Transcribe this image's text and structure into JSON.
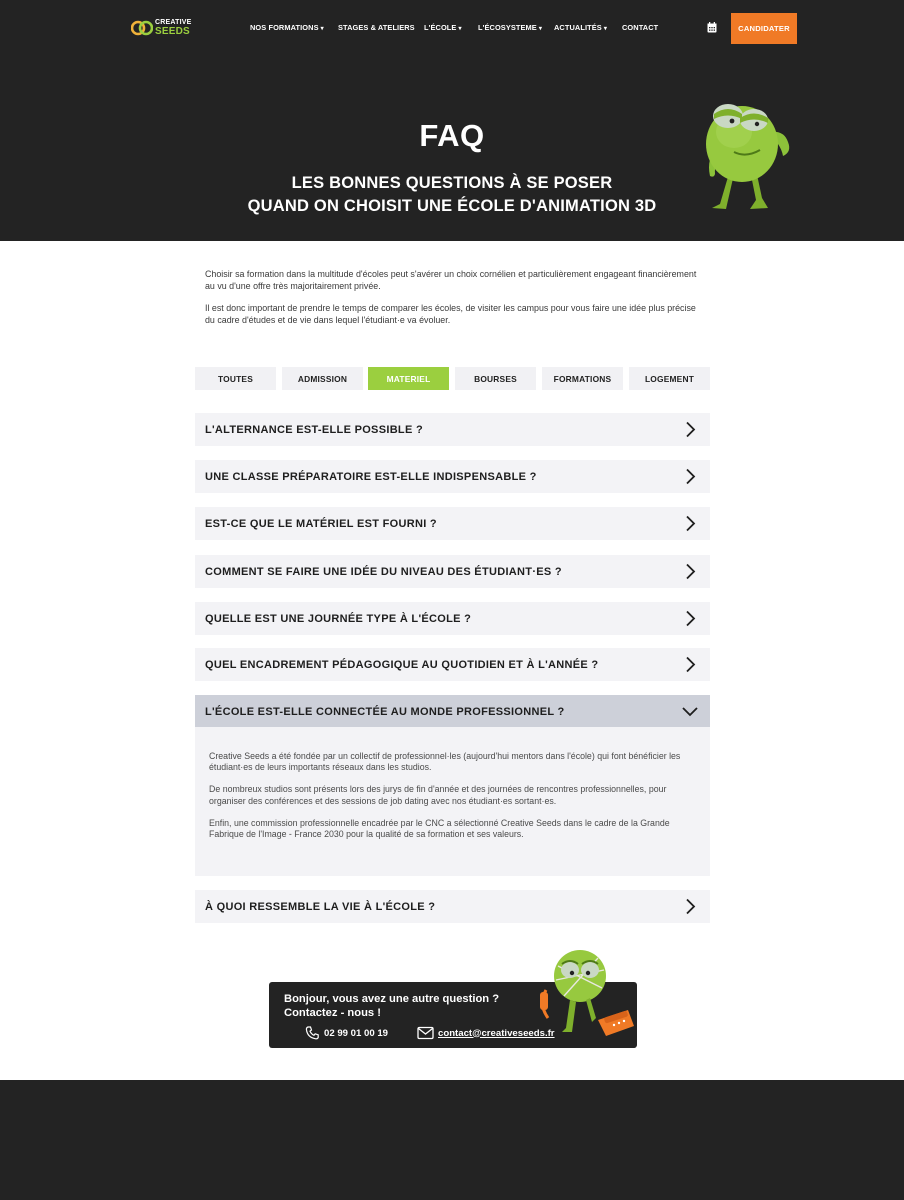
{
  "brand": {
    "name_top": "CREATIVE",
    "name_bottom": "SEEDS",
    "colors": {
      "dark": "#232323",
      "accent_green": "#9bcf3f",
      "accent_orange": "#f07a26"
    }
  },
  "nav": {
    "items": [
      {
        "label": "NOS FORMATIONS",
        "has_dropdown": true
      },
      {
        "label": "STAGES & ATELIERS",
        "has_dropdown": false
      },
      {
        "label": "L'ÉCOLE",
        "has_dropdown": true
      },
      {
        "label": "L'ÉCOSYSTEME",
        "has_dropdown": true
      },
      {
        "label": "ACTUALITÉS",
        "has_dropdown": true
      },
      {
        "label": "CONTACT",
        "has_dropdown": false
      }
    ],
    "caret": "▾",
    "calendar_icon": "calendar-icon",
    "cta_label": "CANDIDATER"
  },
  "hero": {
    "title": "FAQ",
    "subtitle_line1": "LES BONNES QUESTIONS À SE POSER",
    "subtitle_line2": "QUAND ON CHOISIT UNE ÉCOLE D'ANIMATION 3D"
  },
  "intro": {
    "p1": "Choisir sa formation dans la multitude d'écoles peut s'avérer un choix cornélien et particulièrement engageant financièrement au vu d'une offre très majoritairement privée.",
    "p2": "Il est donc important de prendre le temps de comparer les écoles, de visiter les campus pour vous faire une idée plus précise du cadre d'études et de vie dans lequel l'étudiant·e va évoluer."
  },
  "filters": {
    "tabs": [
      "TOUTES",
      "ADMISSION",
      "MATERIEL",
      "BOURSES",
      "FORMATIONS",
      "LOGEMENT"
    ],
    "active": "MATERIEL"
  },
  "faq": {
    "items": [
      {
        "question": "L'ALTERNANCE EST-ELLE POSSIBLE ?",
        "open": false
      },
      {
        "question": "UNE CLASSE PRÉPARATOIRE EST-ELLE INDISPENSABLE ?",
        "open": false
      },
      {
        "question": "EST-CE QUE LE MATÉRIEL EST FOURNI ?",
        "open": false
      },
      {
        "question": "COMMENT SE FAIRE UNE IDÉE DU NIVEAU DES ÉTUDIANT·ES ?",
        "open": false
      },
      {
        "question": "QUELLE EST UNE JOURNÉE TYPE À L'ÉCOLE ?",
        "open": false
      },
      {
        "question": "QUEL ENCADREMENT PÉDAGOGIQUE AU QUOTIDIEN ET À L'ANNÉE ?",
        "open": false
      },
      {
        "question": "L'ÉCOLE EST-ELLE CONNECTÉE AU MONDE PROFESSIONNEL ?",
        "open": true
      },
      {
        "question": "À QUOI RESSEMBLE LA VIE À L'ÉCOLE ?",
        "open": false
      }
    ],
    "open_answer": {
      "p1": "Creative Seeds a été fondée par un collectif de professionnel·les (aujourd'hui mentors dans l'école) qui font bénéficier les étudiant·es de leurs importants réseaux dans les studios.",
      "p2": "De nombreux studios sont présents lors des jurys de fin d'année et des journées de rencontres professionnelles, pour organiser des conférences et des sessions de job dating avec nos étudiant·es sortant·es.",
      "p3": "Enfin, une commission professionnelle encadrée par le CNC a sélectionné Creative Seeds dans le cadre de la Grande Fabrique de l'Image - France 2030 pour la qualité de sa formation et ses valeurs."
    }
  },
  "contact": {
    "message_line1": "Bonjour, vous avez une autre question ?",
    "message_line2": "Contactez - nous !",
    "phone": "02 99 01 00 19",
    "email": "contact@creativeseeds.fr",
    "phone_icon": "phone-icon",
    "email_icon": "envelope-icon"
  }
}
